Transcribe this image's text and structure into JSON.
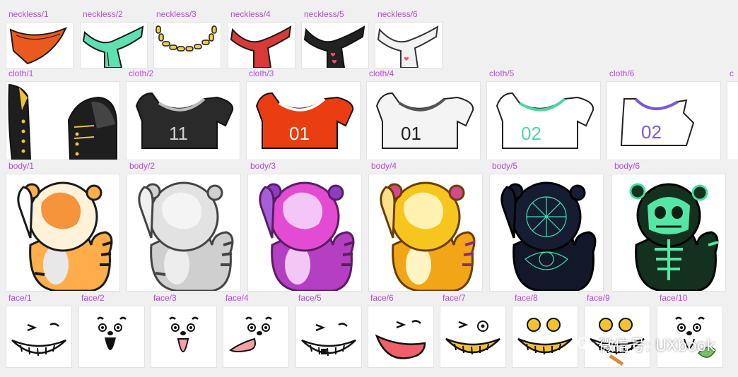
{
  "neckless": [
    {
      "label": "neckless/1",
      "icon": "orange-scarf-icon"
    },
    {
      "label": "neckless/2",
      "icon": "mint-scarf-icon"
    },
    {
      "label": "neckless/3",
      "icon": "gold-chain-icon"
    },
    {
      "label": "neckless/4",
      "icon": "red-scarf-icon"
    },
    {
      "label": "neckless/5",
      "icon": "black-heart-scarf-icon"
    },
    {
      "label": "neckless/6",
      "icon": "white-heart-scarf-icon"
    }
  ],
  "cloth": [
    {
      "label": "cloth/1",
      "icon": "military-jacket-icon"
    },
    {
      "label": "cloth/2",
      "icon": "black-tshirt-icon",
      "number": "11"
    },
    {
      "label": "cloth/3",
      "icon": "red-tshirt-icon",
      "number": "01"
    },
    {
      "label": "cloth/4",
      "icon": "white-tshirt-icon",
      "number": "01"
    },
    {
      "label": "cloth/5",
      "icon": "mint-tshirt-icon",
      "number": "02"
    },
    {
      "label": "cloth/6",
      "icon": "purple-tank-top-icon",
      "number": "02"
    },
    {
      "label": "c",
      "icon": "partial-cloth-icon"
    }
  ],
  "body": [
    {
      "label": "body/1",
      "icon": "orange-tiger-body-icon"
    },
    {
      "label": "body/2",
      "icon": "gray-tiger-body-icon"
    },
    {
      "label": "body/3",
      "icon": "purple-tiger-body-icon"
    },
    {
      "label": "body/4",
      "icon": "gold-tiger-body-icon"
    },
    {
      "label": "body/5",
      "icon": "dark-pattern-tiger-body-icon"
    },
    {
      "label": "body/6",
      "icon": "skeleton-tiger-body-icon"
    }
  ],
  "face": [
    {
      "label": "face/1",
      "icon": "grin-face-icon"
    },
    {
      "label": "face/2",
      "icon": "open-mouth-face-icon"
    },
    {
      "label": "face/3",
      "icon": "tongue-face-icon"
    },
    {
      "label": "face/4",
      "icon": "tongue-out-face-icon"
    },
    {
      "label": "face/5",
      "icon": "toothy-grin-face-icon"
    },
    {
      "label": "face/6",
      "icon": "red-mouth-face-icon"
    },
    {
      "label": "face/7",
      "icon": "gold-grin-face-icon"
    },
    {
      "label": "face/8",
      "icon": "money-eyes-face-icon"
    },
    {
      "label": "face/9",
      "icon": "money-cigar-face-icon"
    },
    {
      "label": "face/10",
      "icon": "leaf-face-icon"
    }
  ],
  "watermark": {
    "text": "微信号: UXbook",
    "icon": "wechat-logo-icon"
  },
  "colors": {
    "label": "#b64bd8",
    "tile_bg": "#ffffff",
    "page_bg": "#f0f0f0"
  }
}
